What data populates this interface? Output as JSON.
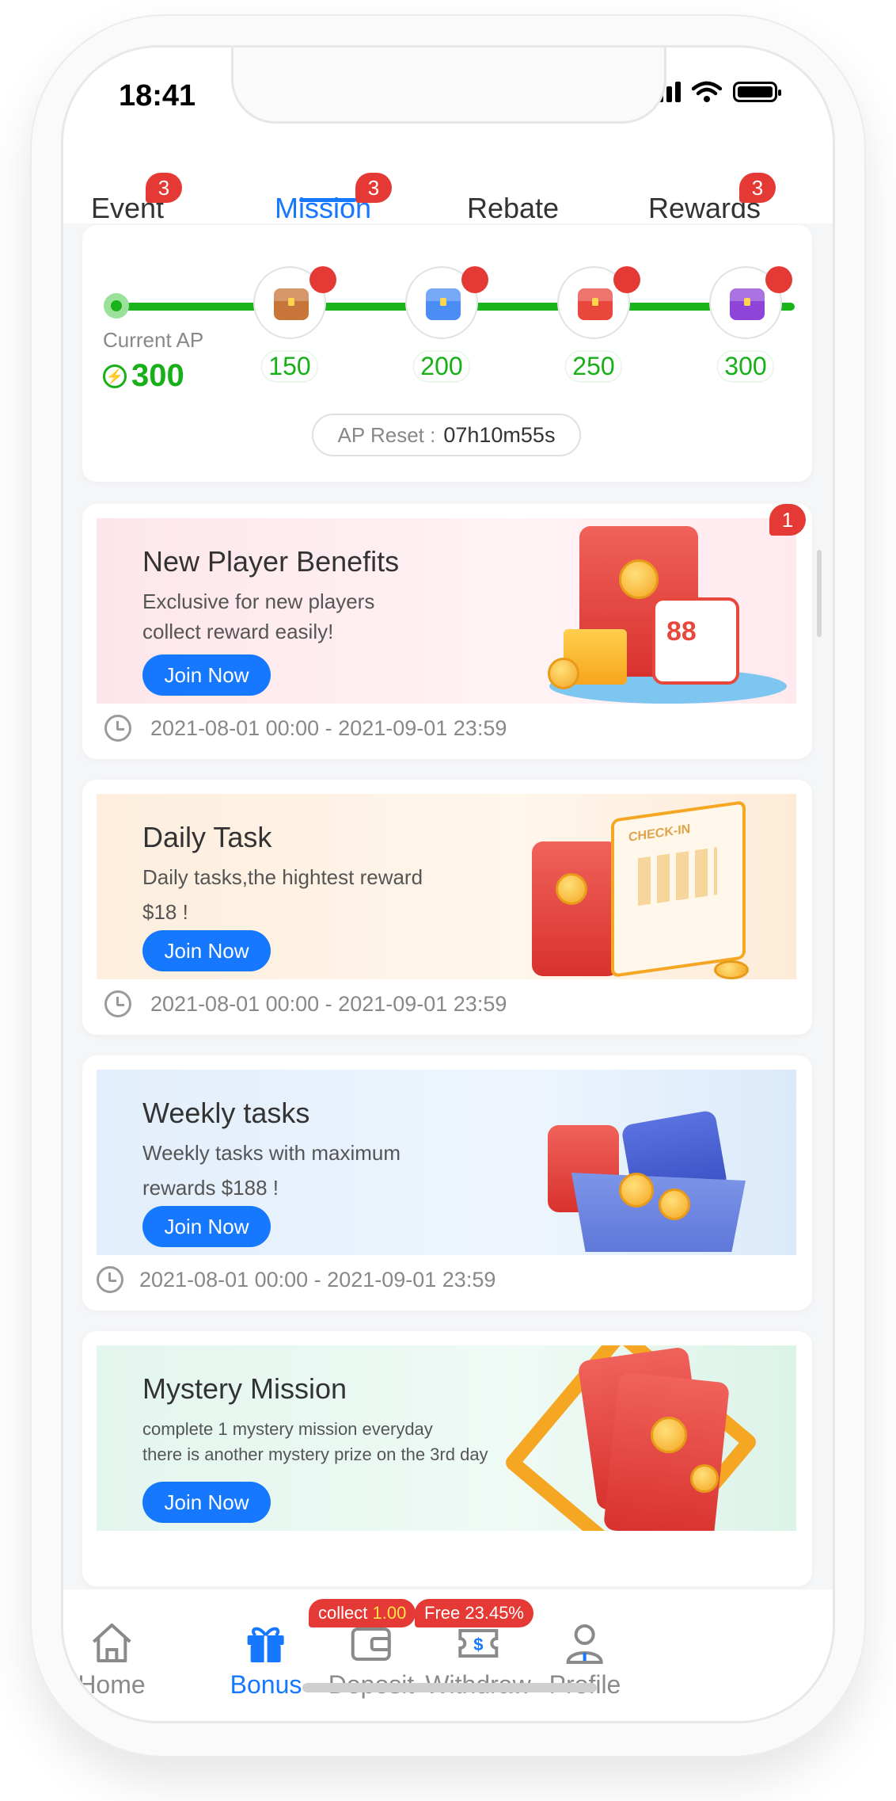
{
  "status_bar": {
    "time": "18:41"
  },
  "tabs": [
    {
      "label": "Event",
      "badge": "3"
    },
    {
      "label": "Mission",
      "badge": "3",
      "active": true
    },
    {
      "label": "Rebate"
    },
    {
      "label": "Rewards",
      "badge": "3"
    }
  ],
  "ap": {
    "current_label": "Current AP",
    "current_value": "300",
    "milestones": [
      {
        "value": "150",
        "chest_color": "#c8753a"
      },
      {
        "value": "200",
        "chest_color": "#4a8df5"
      },
      {
        "value": "250",
        "chest_color": "#e8473c"
      },
      {
        "value": "300",
        "chest_color": "#8e44d9"
      }
    ],
    "reset_label": "AP Reset :",
    "reset_value": "07h10m55s"
  },
  "missions": [
    {
      "title": "New Player Benefits",
      "desc_line1": "Exclusive for new players",
      "desc_line2": "collect reward easily!",
      "button": "Join Now",
      "time": "2021-08-01 00:00 - 2021-09-01 23:59",
      "badge": "1",
      "envelope_number": "88",
      "bg": "#fde6ea"
    },
    {
      "title": "Daily Task",
      "desc_line1": "Daily tasks,the hightest reward",
      "desc_line2": "$18 !",
      "button": "Join Now",
      "time": "2021-08-01 00:00 - 2021-09-01 23:59",
      "calendar_label": "CHECK-IN",
      "bg": "#fdeedd"
    },
    {
      "title": "Weekly tasks",
      "desc_line1": "Weekly tasks with maximum",
      "desc_line2": "rewards $188 !",
      "button": "Join Now",
      "time": "2021-08-01 00:00 - 2021-09-01 23:59",
      "bg": "#e2eefb"
    },
    {
      "title": "Mystery Mission",
      "desc_line1": "complete 1 mystery mission everyday",
      "desc_line2": "there is another mystery prize on the 3rd day",
      "button": "Join Now",
      "bg": "#e3f6ee"
    }
  ],
  "bottom_nav": [
    {
      "label": "Home",
      "icon": "home-icon"
    },
    {
      "label": "Bonus",
      "icon": "gift-icon",
      "active": true,
      "pill_label": "collect",
      "pill_value": "1.00"
    },
    {
      "label": "Deposit",
      "icon": "wallet-icon",
      "pill_label": "Free",
      "pill_value": "23.45%"
    },
    {
      "label": "Withdraw",
      "icon": "dollar-ticket-icon"
    },
    {
      "label": "Profile",
      "icon": "user-icon"
    }
  ],
  "colors": {
    "accent": "#1677ff",
    "green": "#18b018",
    "badge_red": "#e53935"
  }
}
